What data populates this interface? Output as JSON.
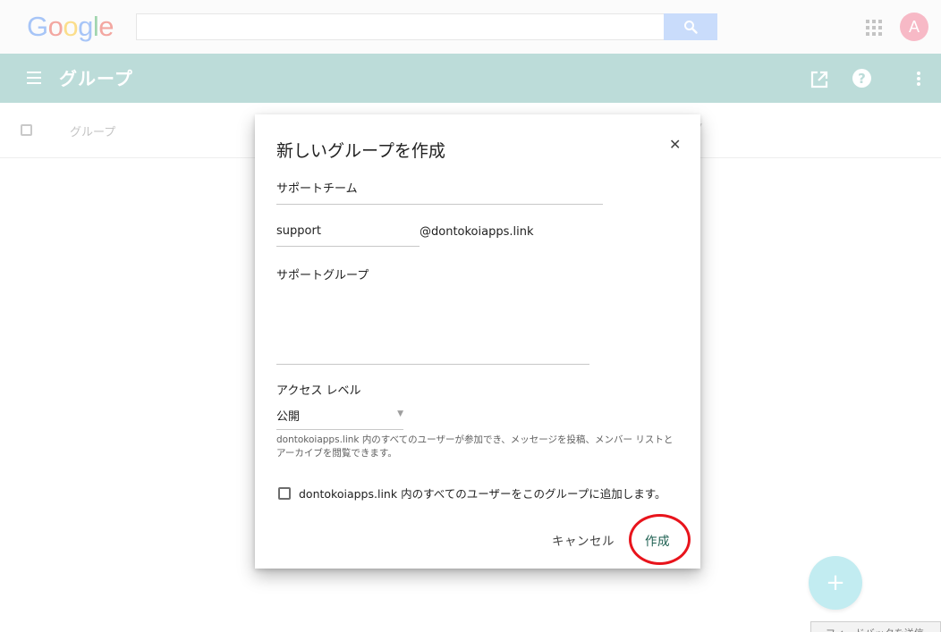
{
  "topbar": {
    "logo_letters": [
      {
        "ch": "G",
        "color": "#4285F4"
      },
      {
        "ch": "o",
        "color": "#EA4335"
      },
      {
        "ch": "o",
        "color": "#FBBC05"
      },
      {
        "ch": "g",
        "color": "#4285F4"
      },
      {
        "ch": "l",
        "color": "#34A853"
      },
      {
        "ch": "e",
        "color": "#EA4335"
      }
    ],
    "search_placeholder": "",
    "avatar_letter": "A"
  },
  "appbar": {
    "title": "グループ",
    "color": "#bcdcd9"
  },
  "list": {
    "column_label": "グループ"
  },
  "dialog": {
    "title": "新しいグループを作成",
    "name_value": "サポートチーム",
    "email_value": "support",
    "domain_suffix": "@dontokoiapps.link",
    "description_value": "サポートグループ",
    "access_label": "アクセス レベル",
    "access_selected": "公開",
    "access_helper": "dontokoiapps.link 内のすべてのユーザーが参加でき、メッセージを投稿、メンバー リストとアーカイブを閲覧できます。",
    "add_all_label": "dontokoiapps.link 内のすべてのユーザーをこのグループに追加します。",
    "add_all_checked": false,
    "cancel_label": "キャンセル",
    "create_label": "作成",
    "highlight_color": "#e8141c"
  },
  "feedback_label": "フィードバックを送信"
}
